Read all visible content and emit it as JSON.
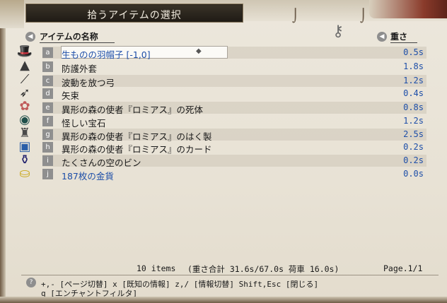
{
  "window": {
    "title": "拾うアイテムの選択"
  },
  "header": {
    "name_col": "アイテムの名称",
    "weight_col": "重さ"
  },
  "items": [
    {
      "slot": "a",
      "name": "生ものの羽帽子 [-1,0]",
      "weight": "0.5s",
      "icon": "feathered-hat-icon",
      "selected": true,
      "name_color": "#1d4ea8"
    },
    {
      "slot": "b",
      "name": "防護外套",
      "weight": "1.8s",
      "icon": "cloak-icon",
      "selected": false,
      "name_color": "#1a1a1a"
    },
    {
      "slot": "c",
      "name": "波動を放つ弓",
      "weight": "1.2s",
      "icon": "bow-icon",
      "selected": false,
      "name_color": "#1a1a1a"
    },
    {
      "slot": "d",
      "name": "矢束",
      "weight": "0.4s",
      "icon": "arrow-bundle-icon",
      "selected": false,
      "name_color": "#1a1a1a"
    },
    {
      "slot": "e",
      "name": "異形の森の使者『ロミアス』の死体",
      "weight": "0.8s",
      "icon": "corpse-icon",
      "selected": false,
      "name_color": "#1a1a1a"
    },
    {
      "slot": "f",
      "name": "怪しい宝石",
      "weight": "1.2s",
      "icon": "gem-icon",
      "selected": false,
      "name_color": "#1a1a1a"
    },
    {
      "slot": "g",
      "name": "異形の森の使者『ロミアス』のはく製",
      "weight": "2.5s",
      "icon": "figurine-icon",
      "selected": false,
      "name_color": "#1a1a1a"
    },
    {
      "slot": "h",
      "name": "異形の森の使者『ロミアス』のカード",
      "weight": "0.2s",
      "icon": "card-icon",
      "selected": false,
      "name_color": "#1a1a1a"
    },
    {
      "slot": "i",
      "name": "たくさんの空のビン",
      "weight": "0.2s",
      "icon": "bottle-icon",
      "selected": false,
      "name_color": "#1a1a1a"
    },
    {
      "slot": "j",
      "name": "187枚の金貨",
      "weight": "0.0s",
      "icon": "gold-coins-icon",
      "selected": false,
      "name_color": "#1d4ea8"
    }
  ],
  "footer": {
    "count": "10 items",
    "weight_total": "(重さ合計 31.6s/67.0s  荷車 16.0s)",
    "page": "Page.1/1"
  },
  "help": {
    "line1": "+,- [ページ切替]  x [既知の情報]  z,/ [情報切替]  Shift,Esc [閉じる]",
    "line2": "q [エンチャントフィルタ]"
  },
  "colors": {
    "accent": "#1d4ea8",
    "slot_bg": "#8f8f8f",
    "title_bg": "#2a241b"
  }
}
